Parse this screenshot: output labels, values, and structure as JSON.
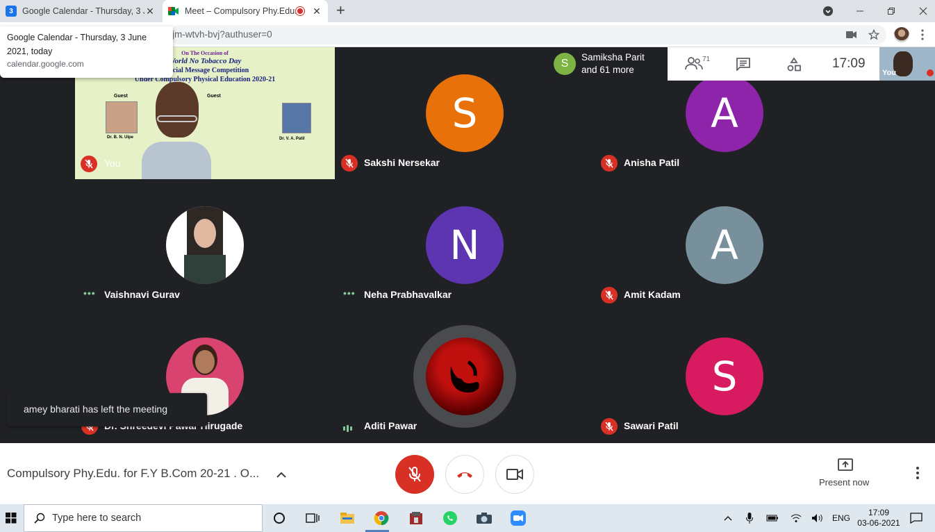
{
  "browser": {
    "tabs": [
      {
        "title": "Google Calendar - Thursday, 3 June 2021, today",
        "favicon_color": "#1a73e8",
        "favicon_text": "3",
        "active": false
      },
      {
        "title": "Meet – Compulsory Phy.Edu. for F.Y B.Com",
        "active": true
      }
    ],
    "url": "jm-wtvh-bvj?authuser=0",
    "tooltip": {
      "title": "Google Calendar - Thursday, 3 June 2021, today",
      "domain": "calendar.google.com"
    }
  },
  "meet": {
    "self_label": "You",
    "poster": {
      "line1": "On The Occasion of",
      "line2": "World No Tobacco Day",
      "line3": "s Social Message Competition",
      "line4": "Under Compulsory Physical Education 2020-21",
      "guest_left": "Guest",
      "guest_right": "Guest",
      "name_left": "Dr. B. N. Ulpe",
      "name_right": "Dr. V. A. Patil"
    },
    "participants": [
      {
        "name": "Sakshi Nersekar",
        "initial": "S",
        "color": "#e8710a",
        "status": "muted"
      },
      {
        "name": "Anisha Patil",
        "initial": "A",
        "color": "#8e24aa",
        "status": "muted"
      },
      {
        "name": "Vaishnavi Gurav",
        "initial": "",
        "color": "#ffffff",
        "status": "dots"
      },
      {
        "name": "Neha Prabhavalkar",
        "initial": "N",
        "color": "#5e35b1",
        "status": "dots"
      },
      {
        "name": "Amit Kadam",
        "initial": "A",
        "color": "#78909c",
        "status": "muted"
      },
      {
        "name": "Dr. Shreedevi Pawar Hirugade",
        "initial": "",
        "color": "#d9436f",
        "status": "muted"
      },
      {
        "name": "Aditi Pawar",
        "initial": "",
        "color": "#7a0000",
        "status": "speaking"
      },
      {
        "name": "Sawari Patil",
        "initial": "S",
        "color": "#d81b60",
        "status": "muted"
      }
    ],
    "toast": "amey bharati has left the meeting",
    "top_panel": {
      "presenter_initial": "S",
      "presenter_line1": "Samiksha Parit",
      "presenter_line2": "and 61 more",
      "people_count": "71",
      "time": "17:09",
      "self_preview_label": "You"
    },
    "bottom": {
      "meeting_title": "Compulsory Phy.Edu. for F.Y B.Com 20-21 . O...",
      "present_now": "Present now"
    }
  },
  "taskbar": {
    "search_placeholder": "Type here to search",
    "language": "ENG",
    "time": "17:09",
    "date": "03-06-2021"
  },
  "colors": {
    "muted_red": "#d93025",
    "meet_dark": "#202124"
  }
}
